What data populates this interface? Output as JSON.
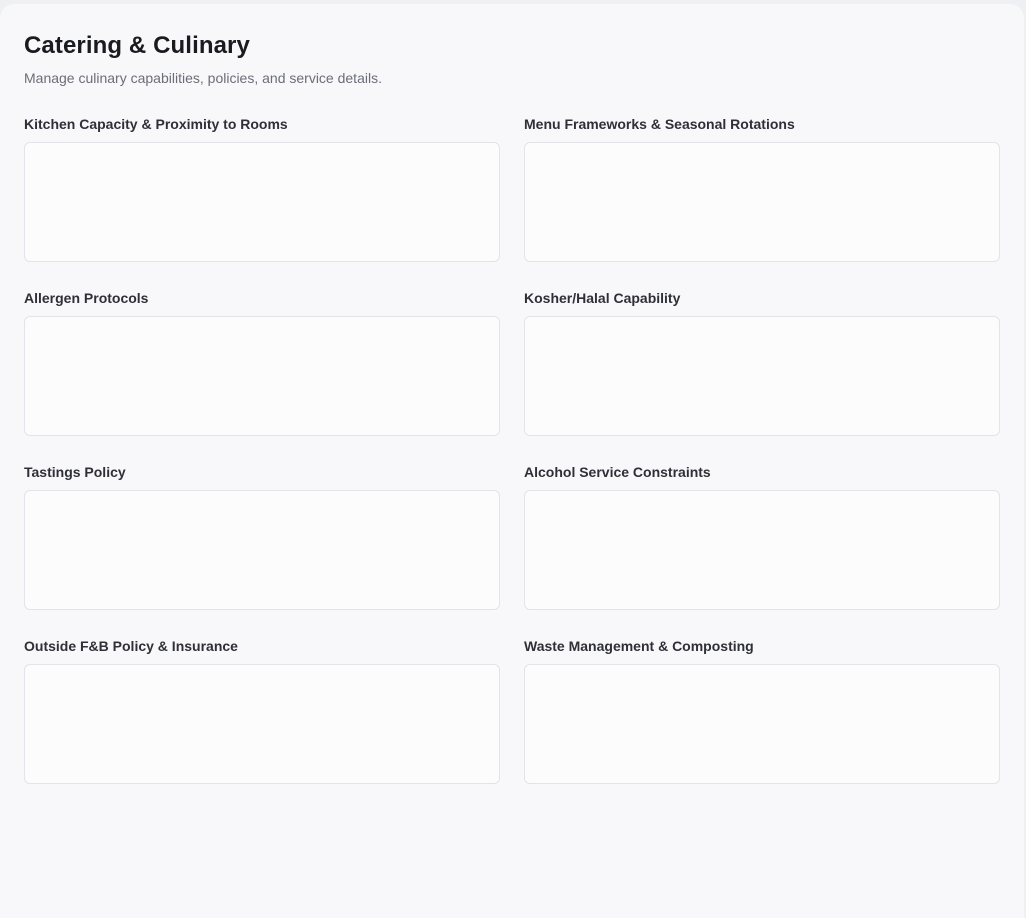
{
  "header": {
    "title": "Catering & Culinary",
    "subtitle": "Manage culinary capabilities, policies, and service details."
  },
  "fields": [
    {
      "label": "Kitchen Capacity & Proximity to Rooms",
      "value": ""
    },
    {
      "label": "Menu Frameworks & Seasonal Rotations",
      "value": ""
    },
    {
      "label": "Allergen Protocols",
      "value": ""
    },
    {
      "label": "Kosher/Halal Capability",
      "value": ""
    },
    {
      "label": "Tastings Policy",
      "value": ""
    },
    {
      "label": "Alcohol Service Constraints",
      "value": ""
    },
    {
      "label": "Outside F&B Policy & Insurance",
      "value": ""
    },
    {
      "label": "Waste Management & Composting",
      "value": ""
    }
  ]
}
